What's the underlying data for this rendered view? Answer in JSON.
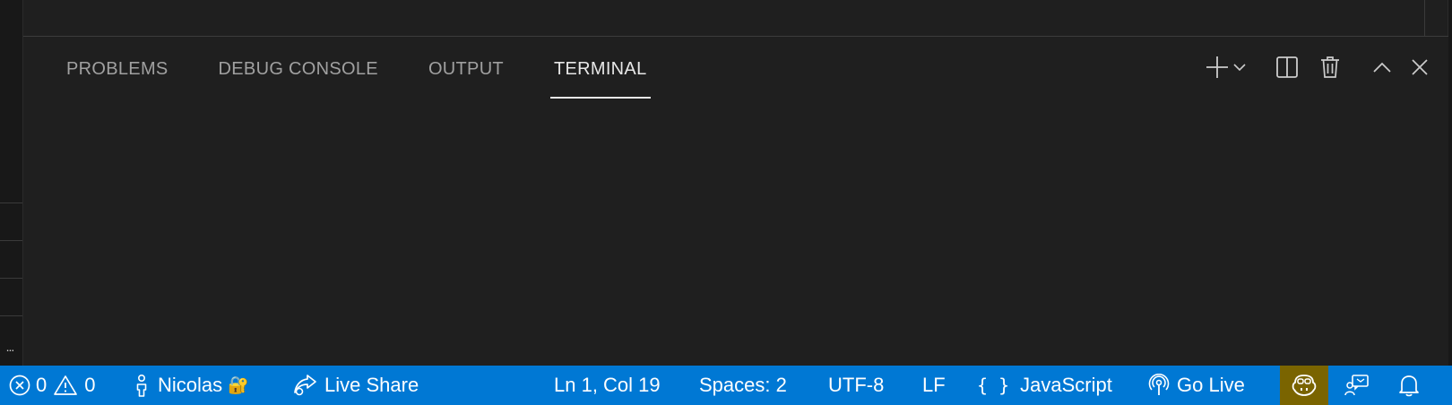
{
  "panel": {
    "tabs": [
      {
        "label": "PROBLEMS",
        "active": false
      },
      {
        "label": "DEBUG CONSOLE",
        "active": false
      },
      {
        "label": "OUTPUT",
        "active": false
      },
      {
        "label": "TERMINAL",
        "active": true
      }
    ],
    "actions": {
      "new_terminal_icon": "plus-icon",
      "dropdown_icon": "chevron-down-icon",
      "split_icon": "split-terminal-icon",
      "kill_icon": "trash-icon",
      "maximize_icon": "chevron-up-icon",
      "close_icon": "close-icon"
    }
  },
  "sidebar": {
    "more": "..."
  },
  "status_bar": {
    "background": "#0078d4",
    "errors": "0",
    "warnings": "0",
    "account": "Nicolas",
    "account_badge": "🔐",
    "live_share": "Live Share",
    "cursor_position": "Ln 1, Col 19",
    "indentation": "Spaces: 2",
    "encoding": "UTF-8",
    "eol": "LF",
    "language_braces": "{ }",
    "language": "JavaScript",
    "go_live": "Go Live",
    "copilot_bg": "#7a6400"
  }
}
